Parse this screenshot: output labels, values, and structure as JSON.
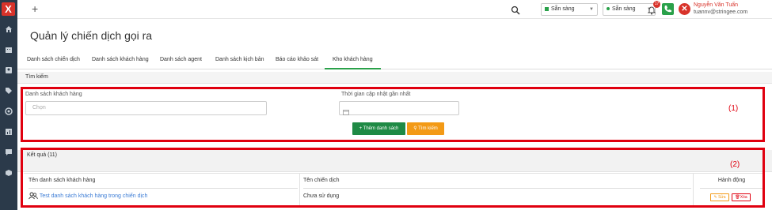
{
  "topbar": {
    "add_label": "+",
    "status_1": "Sẵn sàng",
    "status_2": "Sẵn sàng",
    "notification_count": "17",
    "user_name": "Nguyễn Văn Tuấn",
    "user_email": "tuannv@stringee.com"
  },
  "sidebar": {
    "logo": "X",
    "items": [
      "home-icon",
      "building-icon",
      "contact-icon",
      "tag-icon",
      "target-icon",
      "report-icon",
      "chat-icon",
      "box-icon"
    ]
  },
  "page": {
    "title": "Quản lý chiến dịch gọi ra"
  },
  "tabs": [
    {
      "label": "Danh sách chiến dịch"
    },
    {
      "label": "Danh sách khách hàng"
    },
    {
      "label": "Danh sách agent"
    },
    {
      "label": "Danh sách kịch bản"
    },
    {
      "label": "Báo cáo khảo sát"
    },
    {
      "label": "Kho khách hàng"
    }
  ],
  "search": {
    "title": "Tìm kiếm",
    "customer_list_label": "Danh sách khách hàng",
    "customer_list_placeholder": "Chọn",
    "updated_label": "Thời gian cập nhật gần nhất",
    "add_button": "Thêm danh sách",
    "search_button": "Tìm kiếm",
    "marker": "(1)"
  },
  "results": {
    "title": "Kết quả (11)",
    "marker": "(2)",
    "columns": [
      "Tên danh sách khách hàng",
      "Tên chiến dịch",
      "Hành động"
    ],
    "rows": [
      {
        "name": "Test danh sách khách hàng trong chiến dịch",
        "campaign": "Chưa sử dụng",
        "edit": "Sửa",
        "delete": "Xóa"
      }
    ]
  },
  "colors": {
    "accent_green": "#2aa14a",
    "accent_orange": "#f39a16",
    "highlight_red": "#e0000f",
    "sidebar_bg": "#2b3a4a"
  }
}
